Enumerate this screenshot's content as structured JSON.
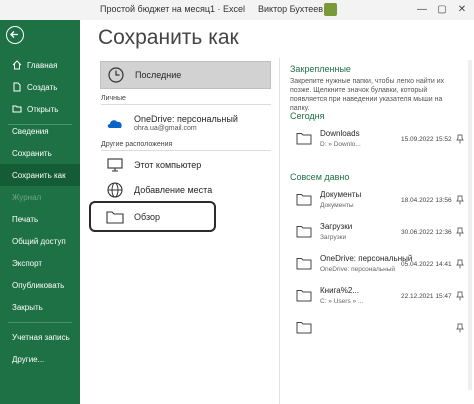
{
  "titlebar": {
    "doc_title": "Простой бюджет на месяц1 · Excel",
    "user_name": "Виктор Бухтеев",
    "minimize": "—",
    "restore": "▢",
    "close": "✕"
  },
  "colors": {
    "sidebar": "#1e7145",
    "selected": "#145c36",
    "accent": "#1e7145"
  },
  "sidebar": {
    "items": [
      {
        "label": "Главная",
        "icon": "home-icon"
      },
      {
        "label": "Создать",
        "icon": "new-file-icon"
      },
      {
        "label": "Открыть",
        "icon": "folder-open-icon"
      },
      {
        "label": "Сведения"
      },
      {
        "label": "Сохранить"
      },
      {
        "label": "Сохранить как"
      },
      {
        "label": "Журнал"
      },
      {
        "label": "Печать"
      },
      {
        "label": "Общий доступ"
      },
      {
        "label": "Экспорт"
      },
      {
        "label": "Опубликовать"
      },
      {
        "label": "Закрыть"
      },
      {
        "label": "Учетная запись"
      },
      {
        "label": "Другие..."
      }
    ]
  },
  "main": {
    "title": "Сохранить как",
    "locations": {
      "recent": {
        "label": "Последние",
        "icon": "clock-icon"
      },
      "personal_header": "Личные",
      "onedrive": {
        "label": "OneDrive: персональный",
        "sub": "ohra.ua@gmail.com",
        "icon": "onedrive-icon"
      },
      "other_header": "Другие расположения",
      "this_pc": {
        "label": "Этот компьютер",
        "icon": "computer-icon"
      },
      "add_place": {
        "label": "Добавление места",
        "icon": "globe-icon"
      },
      "browse": {
        "label": "Обзор",
        "icon": "folder-icon"
      }
    },
    "pinned": {
      "header": "Закрепленные",
      "description": "Закрепите нужные папки, чтобы легко найти их позже. Щелкните значок булавки, который появляется при наведении указателя мыши на папку."
    },
    "today": {
      "header": "Сегодня",
      "folders": [
        {
          "name": "Downloads",
          "path": "D: » Downlo...",
          "date": "15.09.2022 15:52"
        }
      ]
    },
    "long_ago": {
      "header": "Совсем давно",
      "folders": [
        {
          "name": "Документы",
          "path": "Документы",
          "date": "18.04.2022 13:56"
        },
        {
          "name": "Загрузки",
          "path": "Загрузки",
          "date": "30.06.2022 12:36"
        },
        {
          "name": "OneDrive: персональный",
          "path": "OneDrive: персональный",
          "date": "05.04.2022 14:41"
        },
        {
          "name": "Книга%2...",
          "path": "C: » Users » ...",
          "date": "22.12.2021 15:47"
        },
        {
          "name": "",
          "path": "",
          "date": ""
        }
      ]
    }
  }
}
